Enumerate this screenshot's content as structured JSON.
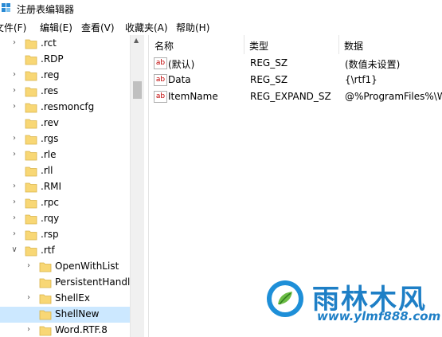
{
  "window": {
    "title": "注册表编辑器"
  },
  "menu": [
    "文件(F)",
    "编辑(E)",
    "查看(V)",
    "收藏夹(A)",
    "帮助(H)"
  ],
  "tree": {
    "items": [
      {
        "label": ".rct",
        "expandable": true,
        "expanded": false,
        "depth": 0
      },
      {
        "label": ".RDP",
        "expandable": false,
        "expanded": false,
        "depth": 0
      },
      {
        "label": ".reg",
        "expandable": true,
        "expanded": false,
        "depth": 0
      },
      {
        "label": ".res",
        "expandable": true,
        "expanded": false,
        "depth": 0
      },
      {
        "label": ".resmoncfg",
        "expandable": true,
        "expanded": false,
        "depth": 0
      },
      {
        "label": ".rev",
        "expandable": false,
        "expanded": false,
        "depth": 0
      },
      {
        "label": ".rgs",
        "expandable": true,
        "expanded": false,
        "depth": 0
      },
      {
        "label": ".rle",
        "expandable": true,
        "expanded": false,
        "depth": 0
      },
      {
        "label": ".rll",
        "expandable": false,
        "expanded": false,
        "depth": 0
      },
      {
        "label": ".RMI",
        "expandable": true,
        "expanded": false,
        "depth": 0
      },
      {
        "label": ".rpc",
        "expandable": true,
        "expanded": false,
        "depth": 0
      },
      {
        "label": ".rqy",
        "expandable": true,
        "expanded": false,
        "depth": 0
      },
      {
        "label": ".rsp",
        "expandable": true,
        "expanded": false,
        "depth": 0
      },
      {
        "label": ".rtf",
        "expandable": true,
        "expanded": true,
        "depth": 0
      },
      {
        "label": "OpenWithList",
        "expandable": true,
        "expanded": false,
        "depth": 1
      },
      {
        "label": "PersistentHandler",
        "expandable": false,
        "expanded": false,
        "depth": 1
      },
      {
        "label": "ShellEx",
        "expandable": true,
        "expanded": false,
        "depth": 1
      },
      {
        "label": "ShellNew",
        "expandable": false,
        "expanded": false,
        "depth": 1,
        "selected": true
      },
      {
        "label": "Word.RTF.8",
        "expandable": true,
        "expanded": false,
        "depth": 1
      }
    ]
  },
  "columns": {
    "name": "名称",
    "type": "类型",
    "data": "数据"
  },
  "values": [
    {
      "icon": "ab",
      "name": "(默认)",
      "type": "REG_SZ",
      "data": "(数值未设置)"
    },
    {
      "icon": "ab",
      "name": "Data",
      "type": "REG_SZ",
      "data": "{\\rtf1}"
    },
    {
      "icon": "ab",
      "name": "ItemName",
      "type": "REG_EXPAND_SZ",
      "data": "@%ProgramFiles%\\Windows NT"
    }
  ],
  "watermark": {
    "text": "雨林木风",
    "url": "www.ylmf888.com"
  },
  "colors": {
    "selected": "#cce8ff",
    "brand": "#1e7fc6",
    "folder": "#f8d775"
  },
  "icons": {
    "app": "regedit-icon",
    "folder": "folder-icon",
    "value": "string-value-icon",
    "expand": "chevron-right-icon",
    "collapse": "chevron-down-icon"
  }
}
